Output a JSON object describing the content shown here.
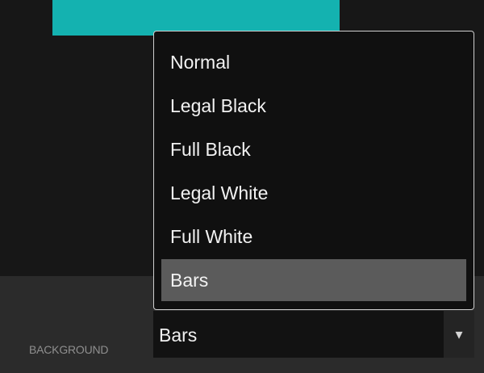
{
  "background_control": {
    "label": "BACKGROUND",
    "selected_value": "Bars",
    "chevron": "▾",
    "options": [
      {
        "label": "Normal"
      },
      {
        "label": "Legal Black"
      },
      {
        "label": "Full Black"
      },
      {
        "label": "Legal White"
      },
      {
        "label": "Full White"
      },
      {
        "label": "Bars",
        "selected": true
      }
    ]
  },
  "colors": {
    "preview_accent": "#14b2b0",
    "panel_background": "#2b2b2b",
    "dropdown_background": "#101010",
    "selected_option": "#5b5b5b"
  },
  "icons": {
    "dropdown_arrow": "chevron-down-icon"
  }
}
